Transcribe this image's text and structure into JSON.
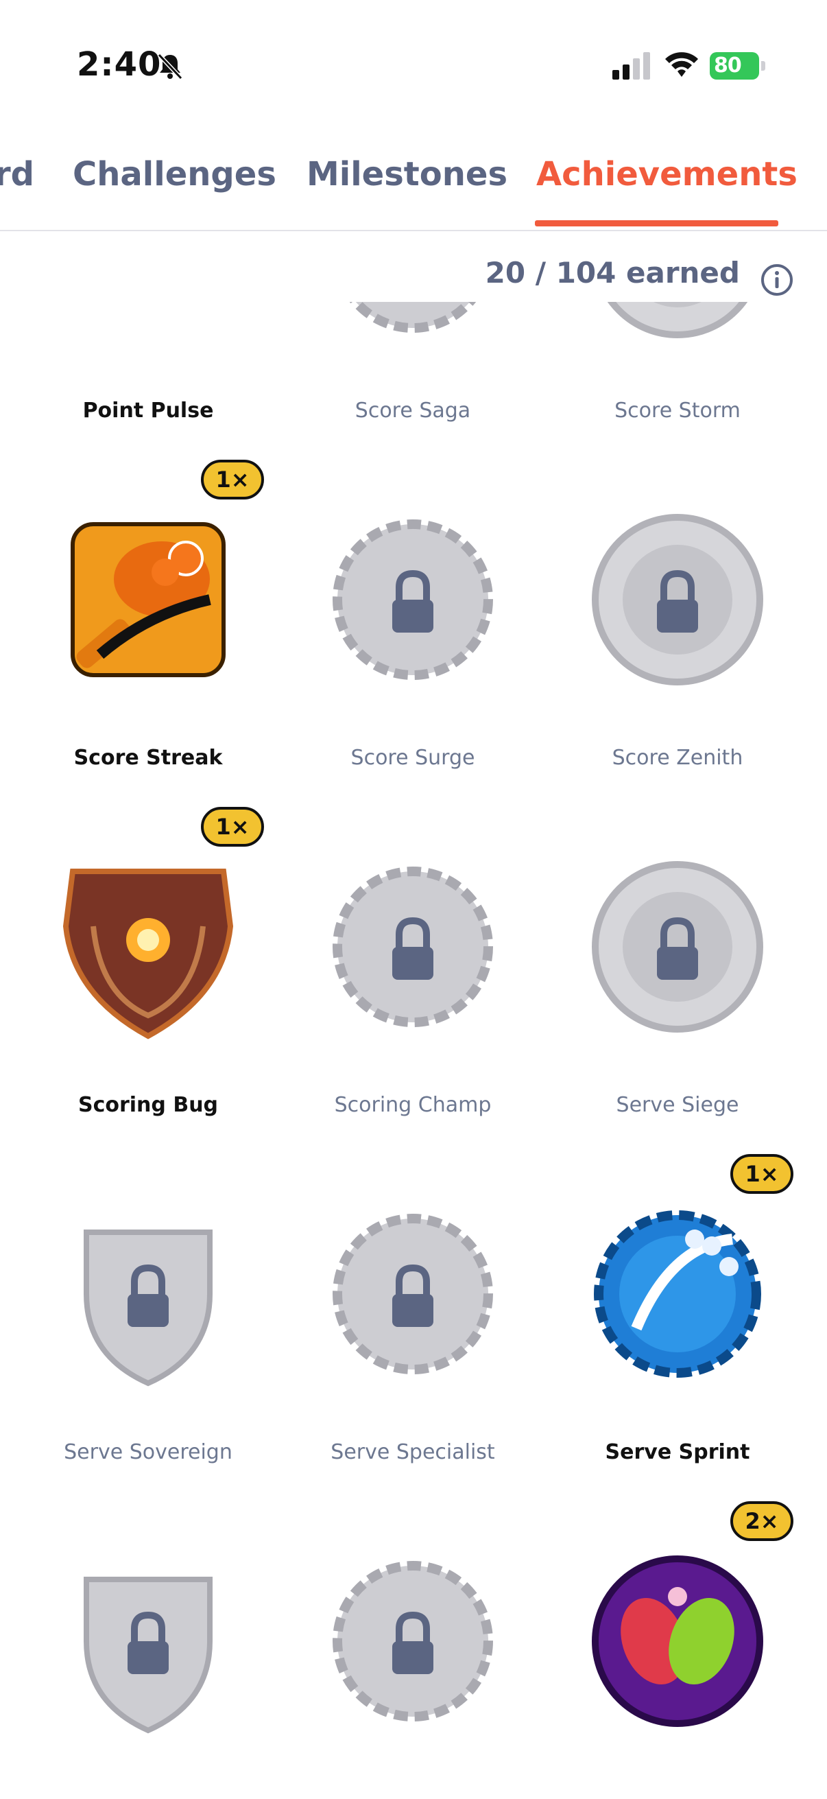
{
  "status_bar": {
    "time": "2:40",
    "battery": "80",
    "icons": [
      "bell-slash-icon",
      "signal-icon",
      "wifi-icon",
      "battery-icon"
    ]
  },
  "tabs": [
    {
      "label": "rd",
      "active": false
    },
    {
      "label": "Challenges",
      "active": false
    },
    {
      "label": "Milestones",
      "active": false
    },
    {
      "label": "Achievements",
      "active": true
    }
  ],
  "summary": {
    "earned_text": "20 / 104 earned"
  },
  "colors": {
    "accent": "#f15b3d",
    "muted": "#5b6582",
    "pill": "#f2c230"
  },
  "badges": [
    {
      "name": "Point Pulse",
      "locked": false,
      "count": ""
    },
    {
      "name": "Score Saga",
      "locked": true,
      "count": ""
    },
    {
      "name": "Score Storm",
      "locked": true,
      "count": ""
    },
    {
      "name": "Score Streak",
      "locked": false,
      "count": "1×"
    },
    {
      "name": "Score Surge",
      "locked": true,
      "count": ""
    },
    {
      "name": "Score Zenith",
      "locked": true,
      "count": ""
    },
    {
      "name": "Scoring Bug",
      "locked": false,
      "count": "1×"
    },
    {
      "name": "Scoring Champ",
      "locked": true,
      "count": ""
    },
    {
      "name": "Serve Siege",
      "locked": true,
      "count": ""
    },
    {
      "name": "Serve Sovereign",
      "locked": true,
      "count": ""
    },
    {
      "name": "Serve Specialist",
      "locked": true,
      "count": ""
    },
    {
      "name": "Serve Sprint",
      "locked": false,
      "count": "1×"
    },
    {
      "name": "",
      "locked": true,
      "count": ""
    },
    {
      "name": "",
      "locked": true,
      "count": ""
    },
    {
      "name": "",
      "locked": false,
      "count": "2×"
    }
  ]
}
